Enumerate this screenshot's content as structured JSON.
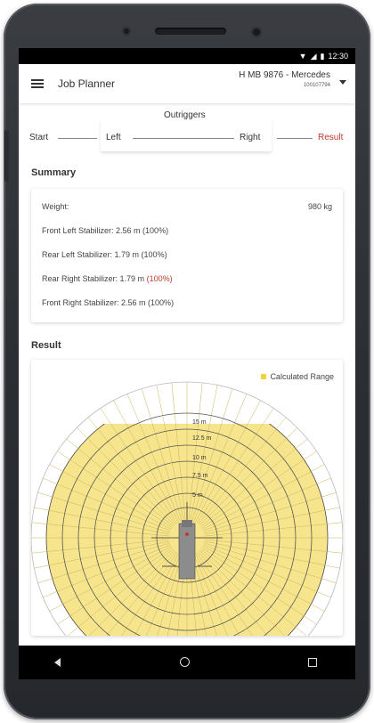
{
  "status_bar": {
    "time": "12:30",
    "icons": [
      "wifi-icon",
      "signal-icon",
      "battery-icon"
    ]
  },
  "app_bar": {
    "title": "Job Planner",
    "vehicle_name": "H MB 9876 - Mercedes",
    "vehicle_id": "100107794"
  },
  "stepper": {
    "group_label": "Outriggers",
    "steps": [
      "Start",
      "Left",
      "Right",
      "Result"
    ],
    "active_color": "#c0392b"
  },
  "summary": {
    "title": "Summary",
    "weight_label": "Weight:",
    "weight_value": "980 kg",
    "rows": [
      "Front Left Stabilizer: 2.56 m (100%)",
      "Rear Left Stabilizer: 1.79 m (100%)",
      "Rear Right Stabilizer: 1.79 m",
      "Front Right Stabilizer: 2.56 m (100%)"
    ],
    "rear_right_pct": "(100%)"
  },
  "result": {
    "title": "Result",
    "legend": "Calculated Range",
    "range_color": "#f7e58e",
    "ring_labels": [
      "15 m",
      "12.5 m",
      "10 m",
      "7.5 m",
      "5 m"
    ]
  },
  "nav_bar": {
    "icons": [
      "back-icon",
      "home-icon",
      "recent-apps-icon"
    ]
  }
}
